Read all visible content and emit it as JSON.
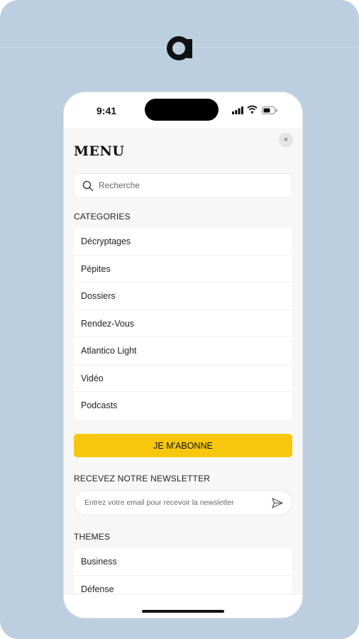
{
  "brand": {
    "logo_letter": "a"
  },
  "status_bar": {
    "time": "9:41"
  },
  "menu": {
    "title": "MENU",
    "close_symbol": "×",
    "search": {
      "placeholder": "Recherche"
    },
    "categories_label": "CATEGORIES",
    "categories": [
      {
        "label": "Décryptages"
      },
      {
        "label": "Pépites"
      },
      {
        "label": "Dossiers"
      },
      {
        "label": "Rendez-Vous"
      },
      {
        "label": "Atlantico Light"
      },
      {
        "label": "Vidéo"
      },
      {
        "label": "Podcasts"
      }
    ],
    "subscribe_label": "JE M'ABONNE",
    "newsletter": {
      "label": "RECEVEZ NOTRE NEWSLETTER",
      "placeholder": "Entrez votre email pour recevoir la newsletter"
    },
    "themes_label": "THEMES",
    "themes": [
      {
        "label": "Business"
      },
      {
        "label": "Défense"
      }
    ]
  },
  "colors": {
    "background": "#bccfe0",
    "accent": "#f8c70d",
    "panel": "#f7f7f7"
  },
  "icons": [
    "search-icon",
    "send-icon",
    "close-icon",
    "signal-icon",
    "wifi-icon",
    "battery-icon"
  ]
}
